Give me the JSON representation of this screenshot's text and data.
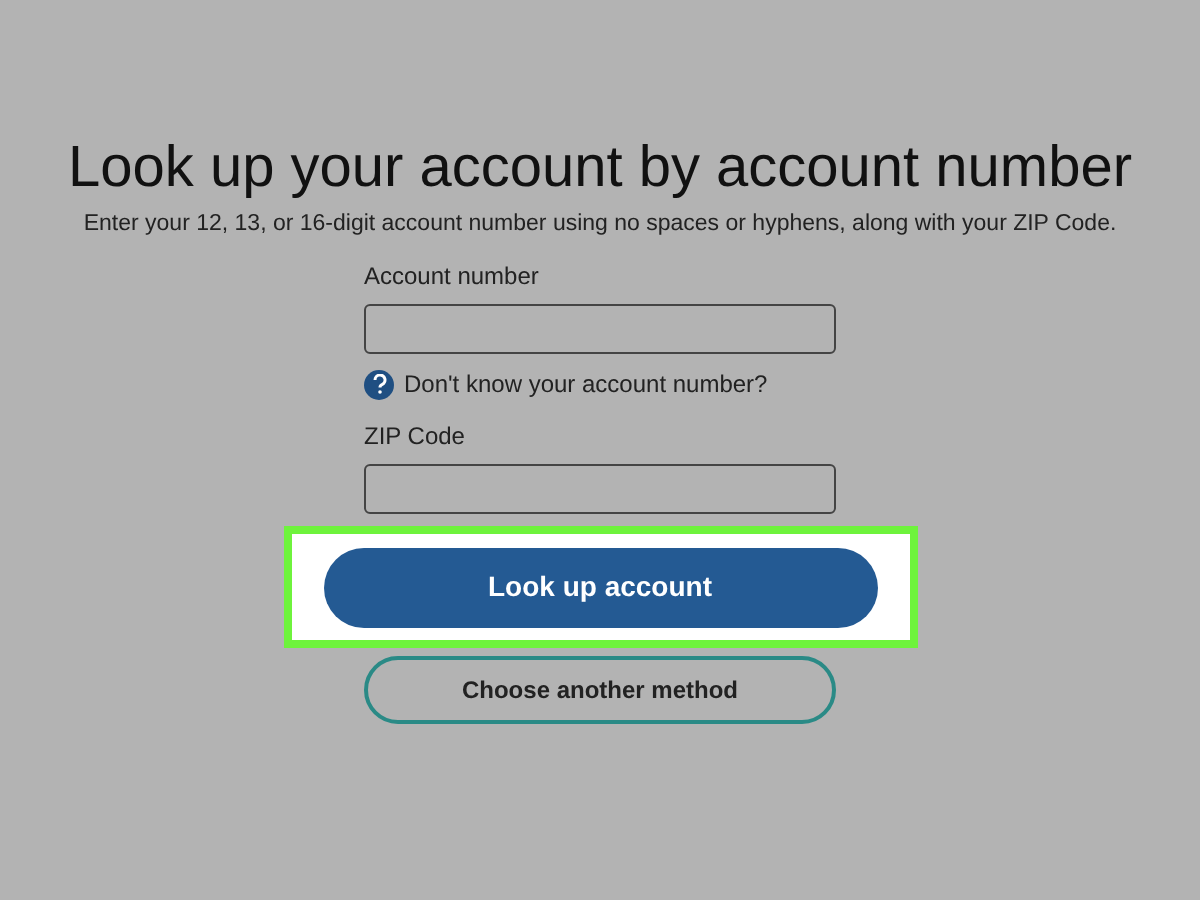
{
  "title": "Look up your account by account number",
  "instructions": "Enter your 12, 13, or 16-digit account number using no spaces or hyphens, along with your ZIP Code.",
  "fields": [
    {
      "label": "Account number",
      "help": "Don't know your account number?"
    },
    {
      "label": "ZIP Code"
    }
  ],
  "primary_button": {
    "label": "Look up account",
    "highlighted": true
  },
  "secondary_button": {
    "label": "Choose another method"
  }
}
